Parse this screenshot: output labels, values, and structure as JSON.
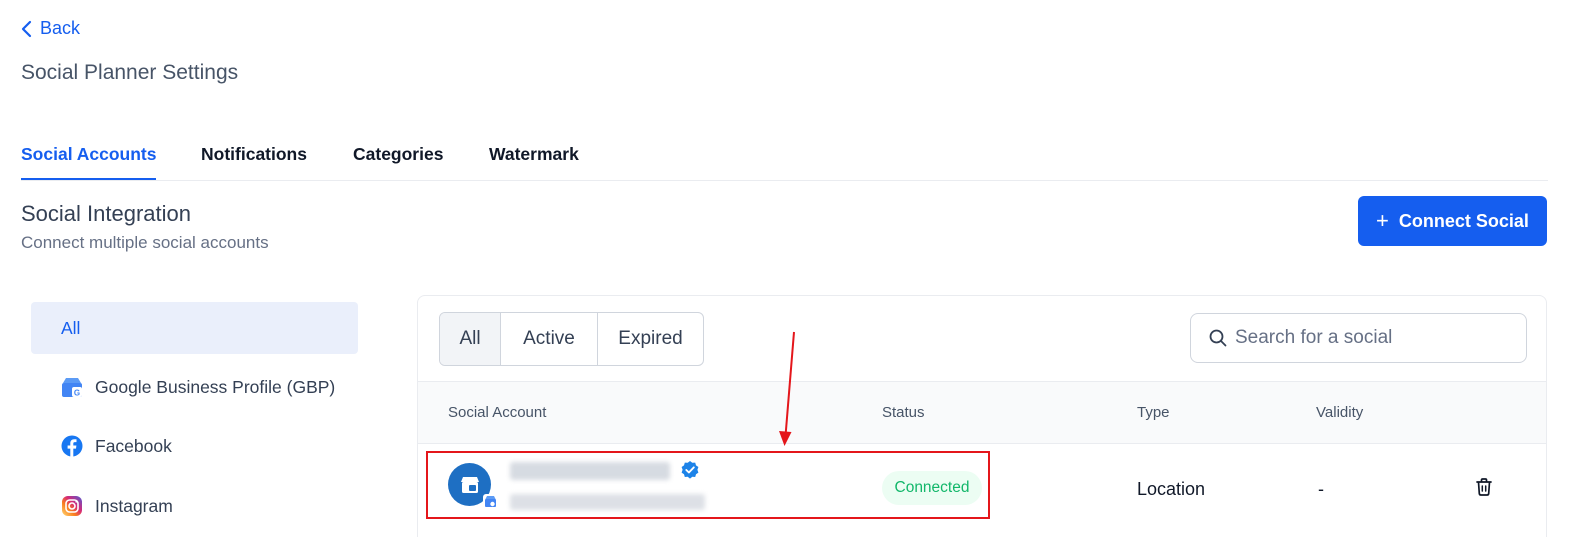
{
  "back": {
    "label": "Back"
  },
  "page_title": "Social Planner Settings",
  "tabs": [
    {
      "label": "Social Accounts",
      "active": true
    },
    {
      "label": "Notifications",
      "active": false
    },
    {
      "label": "Categories",
      "active": false
    },
    {
      "label": "Watermark",
      "active": false
    }
  ],
  "section": {
    "title": "Social Integration",
    "subtitle": "Connect multiple social accounts"
  },
  "connect_button": {
    "label": "Connect Social"
  },
  "sidebar": {
    "items": [
      {
        "label": "All",
        "active": true,
        "icon": ""
      },
      {
        "label": "Google Business Profile (GBP)",
        "active": false,
        "icon": "gbp-icon"
      },
      {
        "label": "Facebook",
        "active": false,
        "icon": "facebook-icon"
      },
      {
        "label": "Instagram",
        "active": false,
        "icon": "instagram-icon"
      }
    ]
  },
  "filter": {
    "options": [
      {
        "label": "All",
        "active": true
      },
      {
        "label": "Active",
        "active": false
      },
      {
        "label": "Expired",
        "active": false
      }
    ]
  },
  "search": {
    "placeholder": "Search for a social",
    "value": ""
  },
  "table": {
    "columns": [
      "Social Account",
      "Status",
      "Type",
      "Validity"
    ],
    "rows": [
      {
        "status": "Connected",
        "type": "Location",
        "validity": "-"
      }
    ]
  },
  "colors": {
    "accent": "#155eef",
    "status_connected": "#12b76a",
    "highlight": "#e4161b"
  }
}
